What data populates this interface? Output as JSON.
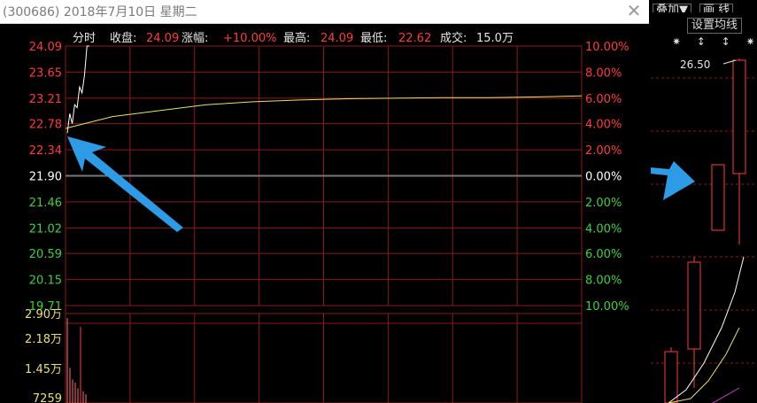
{
  "window": {
    "title": "(300686) 2018年7月10日 星期二",
    "close_icon": "close-icon"
  },
  "info_bar": {
    "mode": "分时",
    "close_label": "收盘:",
    "close_value": "24.09",
    "change_label": "涨幅:",
    "change_value": "+10.00%",
    "high_label": "最高:",
    "high_value": "24.09",
    "low_label": "最低:",
    "low_value": "22.62",
    "volume_label": "成交:",
    "volume_value": "15.0万"
  },
  "price_axis": {
    "left_ticks": [
      "24.09",
      "23.65",
      "23.21",
      "22.78",
      "22.34",
      "21.90",
      "21.46",
      "21.02",
      "20.59",
      "20.15",
      "19.71"
    ],
    "right_ticks": [
      "10.00%",
      "8.00%",
      "6.00%",
      "4.00%",
      "2.00%",
      "0.00%",
      "2.00%",
      "4.00%",
      "6.00%",
      "8.00%",
      "10.00%"
    ]
  },
  "volume_axis": {
    "ticks": [
      "2.90万",
      "2.18万",
      "1.45万",
      "7259"
    ]
  },
  "side_panel": {
    "buttons": [
      "叠加▼",
      "画 线"
    ],
    "ma_setting": "设置均线",
    "ma_icons": [
      "✷",
      "↕",
      "↕",
      "✷"
    ],
    "peak_label": "26.50"
  },
  "colors": {
    "up": "#ff3b3b",
    "down": "#3dd13d",
    "neutral": "#ffffff",
    "price_line": "#ffffff",
    "avg_line": "#e8e06a",
    "grid": "#8b1a1a",
    "arrow": "#2e9be6"
  },
  "chart_data": {
    "type": "line",
    "price_range": [
      19.71,
      24.09
    ],
    "prev_close": 21.9,
    "series": [
      {
        "values": [
          22.62,
          22.95,
          22.78,
          23.1,
          23.05,
          23.4,
          23.3,
          23.6,
          24.09,
          24.09
        ]
      },
      {
        "values": [
          22.7,
          22.9,
          23.0,
          23.1,
          23.15,
          23.18,
          23.2,
          23.21,
          23.22,
          23.22,
          23.23,
          23.25
        ]
      }
    ],
    "volume_range": [
      0,
      29000
    ],
    "volume_values": [
      29000,
      12000,
      8000,
      7000,
      5000,
      26000,
      4000,
      3000
    ]
  }
}
